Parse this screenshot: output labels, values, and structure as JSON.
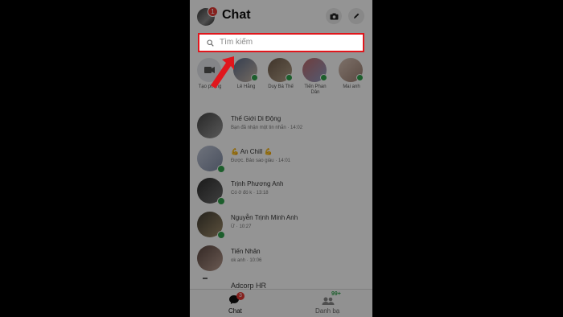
{
  "header": {
    "title": "Chat",
    "badge": "1",
    "camera_icon": "camera-icon",
    "compose_icon": "pencil-icon"
  },
  "search": {
    "placeholder": "Tìm kiếm"
  },
  "stories": [
    {
      "label": "Tạo phòng"
    },
    {
      "label": "Lê Hằng"
    },
    {
      "label": "Duy Bá Thế"
    },
    {
      "label": "Tiến Phan Dân"
    },
    {
      "label": "Mai anh"
    }
  ],
  "chats": [
    {
      "name": "Thế Giới Di Động",
      "snippet": "Bạn đã nhận một tin nhắn · 14:02"
    },
    {
      "name": "💪 An Chill 💪",
      "snippet": "Được. Bảo sao giàu · 14:01"
    },
    {
      "name": "Trịnh Phương Anh",
      "snippet": "Có ở đó k · 13:18"
    },
    {
      "name": "Nguyễn Trịnh Minh Anh",
      "snippet": "Ừ · 10:27"
    },
    {
      "name": "Tiến Nhân",
      "snippet": "ok anh · 10:06"
    },
    {
      "name": "Adcorp HR",
      "snippet": ""
    }
  ],
  "tabs": {
    "chat": {
      "label": "Chat",
      "badge": "3"
    },
    "contacts": {
      "label": "Danh bạ",
      "badge": "99+"
    }
  },
  "colors": {
    "highlight": "#e0161c",
    "online": "#31a24c",
    "badge": "#e53935",
    "dim_overlay": "rgba(0,0,0,0.42)"
  }
}
